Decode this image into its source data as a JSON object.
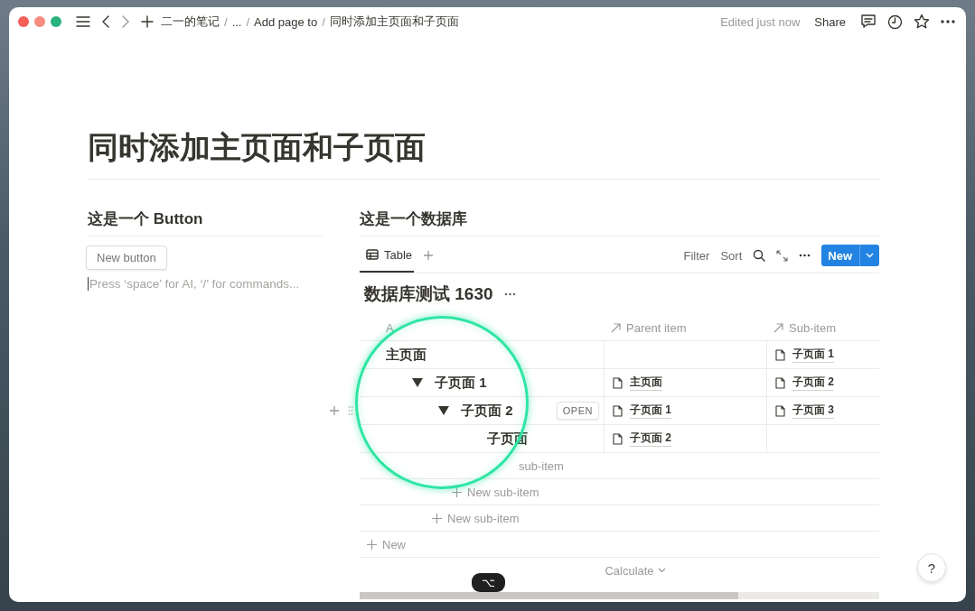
{
  "topbar": {
    "breadcrumbs": [
      "二一的笔记",
      "...",
      "Add page to",
      "同时添加主页面和子页面"
    ],
    "separator": "/",
    "edited": "Edited just now",
    "share": "Share"
  },
  "page": {
    "title": "同时添加主页面和子页面"
  },
  "left": {
    "heading": "这是一个 Button",
    "button": "New button",
    "placeholder": "Press ‘space’ for AI, ‘/’ for commands..."
  },
  "database": {
    "heading": "这是一个数据库",
    "tabs": [
      {
        "label": "Table",
        "selected": true
      }
    ],
    "tools": [
      "Filter",
      "Sort"
    ],
    "new_button": "New",
    "title": "数据库测试 1630",
    "columns": [
      "A",
      "Parent item",
      "Sub-item"
    ],
    "rows": [
      {
        "name": "主页面",
        "sub_item": "子页面 1",
        "children": [
          {
            "name": "子页面 1",
            "expanded": true,
            "parent": "主页面",
            "sub_item": "子页面 2",
            "children": [
              {
                "name": "子页面 2",
                "expanded": true,
                "hover": true,
                "open": "OPEN",
                "parent": "子页面 1",
                "sub_item": "子页面 3",
                "children": [
                  {
                    "name": "子页面",
                    "parent": "子页面 2"
                  }
                ]
              }
            ]
          }
        ]
      }
    ],
    "sub_item_rows": [
      {
        "label": "sub-item",
        "plus": false
      },
      {
        "label": "New sub-item",
        "plus": true
      },
      {
        "label": "New sub-item",
        "plus": true
      }
    ],
    "new_row": "New",
    "calculate": "Calculate"
  },
  "keystroke": "⌥",
  "help": "?"
}
